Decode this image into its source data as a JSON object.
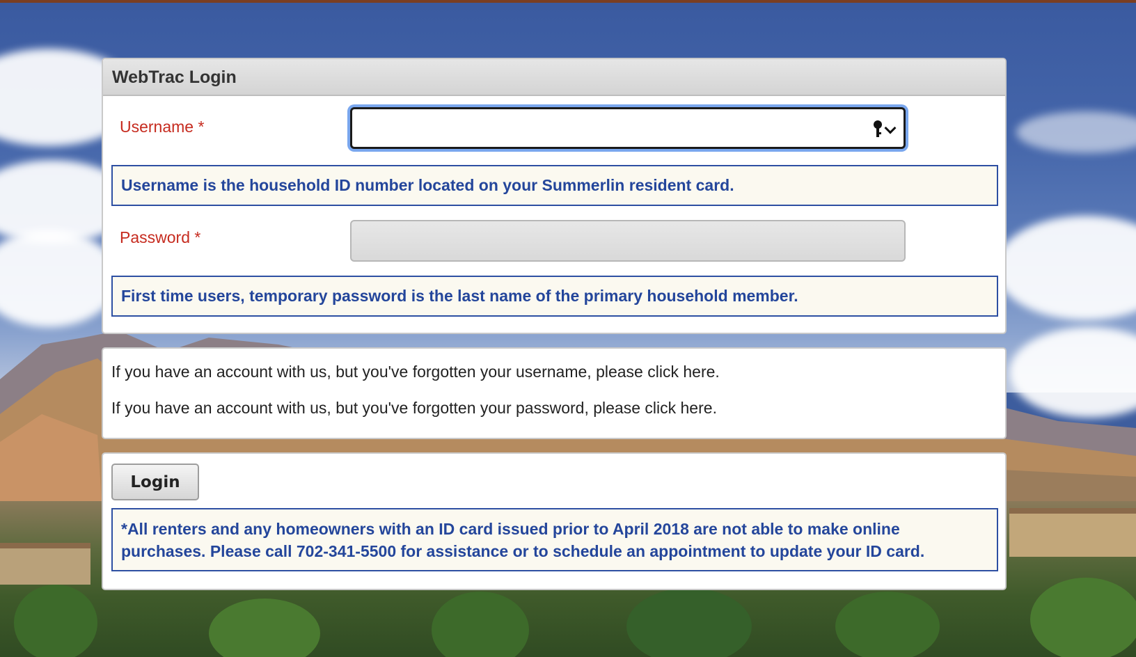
{
  "login_panel": {
    "title": "WebTrac Login",
    "username_label": "Username *",
    "username_value": "",
    "username_hint": "Username is the household ID number located on your Summerlin resident card.",
    "password_label": "Password *",
    "password_value": "",
    "password_hint": "First time users, temporary password is the last name of the primary household member.",
    "icons": [
      "key-icon",
      "chevron-down-icon"
    ]
  },
  "forgot_panel": {
    "username_text": "If you have an account with us, but you've forgotten your username, please click ",
    "username_link": "here",
    "password_text": "If you have an account with us, but you've forgotten your password, please click ",
    "password_link": "here",
    "period": "."
  },
  "submit_panel": {
    "login_label": "Login",
    "notice": "*All renters and any homeowners with an ID card issued prior to April 2018 are not able to make online purchases. Please call 702-341-5500 for assistance or to schedule an appointment to update your ID card."
  },
  "colors": {
    "required_label": "#c62b1f",
    "hint_text": "#24469b",
    "hint_border": "#2d4fa2",
    "hint_background": "#fbf9f0",
    "focus_ring": "#7aa7ee"
  }
}
